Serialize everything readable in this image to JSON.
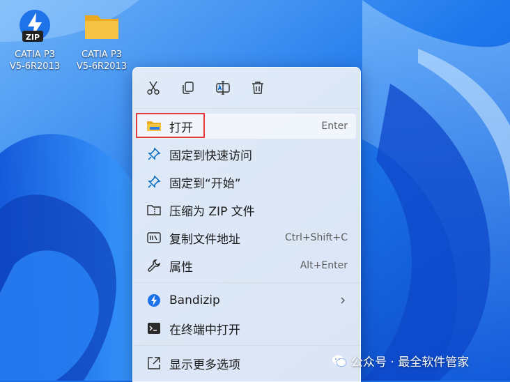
{
  "desktop": {
    "icons": [
      {
        "line1": "CATIA P3",
        "line2": "V5-6R2013",
        "icon": "zip-archive-icon",
        "badge": "ZIP"
      },
      {
        "line1": "CATIA P3",
        "line2": "V5-6R2013",
        "icon": "folder-icon"
      }
    ]
  },
  "menu": {
    "toolbar": [
      "cut-icon",
      "copy-icon",
      "rename-icon",
      "delete-icon"
    ],
    "items": [
      {
        "label": "打开",
        "shortcut": "Enter",
        "icon": "folder-open-icon"
      },
      {
        "label": "固定到快速访问",
        "shortcut": "",
        "icon": "pin-icon"
      },
      {
        "label": "固定到“开始”",
        "shortcut": "",
        "icon": "pin-icon"
      },
      {
        "label": "压缩为 ZIP 文件",
        "shortcut": "",
        "icon": "zip-folder-icon"
      },
      {
        "label": "复制文件地址",
        "shortcut": "Ctrl+Shift+C",
        "icon": "copy-path-icon"
      },
      {
        "label": "属性",
        "shortcut": "Alt+Enter",
        "icon": "wrench-icon"
      },
      {
        "label": "Bandizip",
        "shortcut": "",
        "icon": "bandizip-icon",
        "submenu": true
      },
      {
        "label": "在终端中打开",
        "shortcut": "",
        "icon": "terminal-icon"
      },
      {
        "label": "显示更多选项",
        "shortcut": "",
        "icon": "more-options-icon"
      }
    ]
  },
  "watermark": {
    "text": "公众号 · 最全软件管家"
  },
  "colors": {
    "accent": "#0067c0",
    "highlight": "#e23b3b",
    "folder": "#f6c445"
  }
}
